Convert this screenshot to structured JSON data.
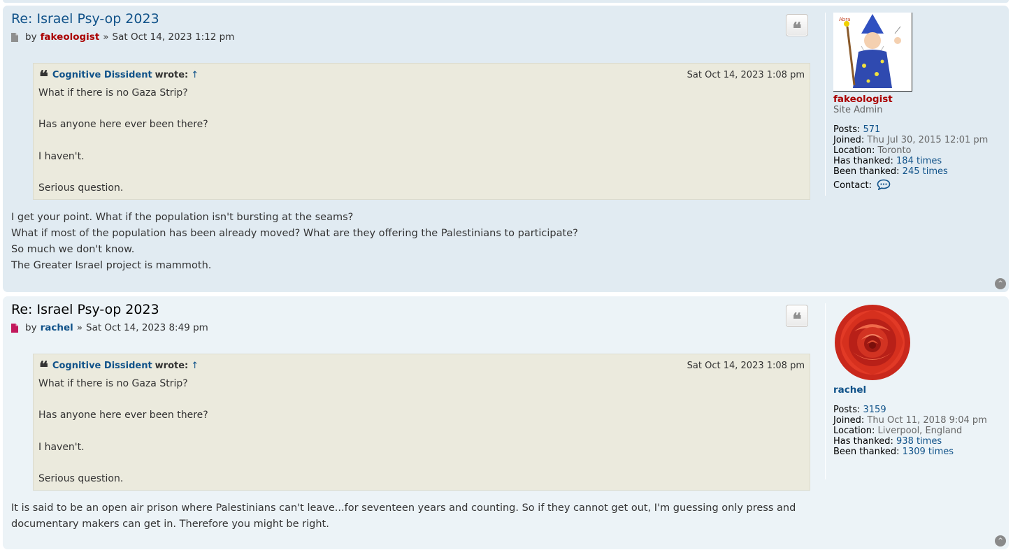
{
  "posts": [
    {
      "title": "Re: Israel Psy-op 2023",
      "by": "by",
      "author": "fakeologist",
      "separator": "»",
      "date": "Sat Oct 14, 2023 1:12 pm",
      "quote_button_glyph": "❝",
      "quote": {
        "author": "Cognitive Dissident",
        "wrote": "wrote:",
        "arrow": "↑",
        "date": "Sat Oct 14, 2023 1:08 pm",
        "lines": [
          "What if there is no Gaza Strip?",
          "",
          "Has anyone here ever been there?",
          "",
          "I haven't.",
          "",
          "Serious question."
        ]
      },
      "body": [
        "I get your point. What if the population isn't bursting at the seams?",
        "What if most of the population has been already moved? What are they offering the Palestinians to participate?",
        "So much we don't know.",
        "The Greater Israel project is mammoth."
      ],
      "profile": {
        "name": "fakeologist",
        "rank": "Site Admin",
        "posts_label": "Posts:",
        "posts": "571",
        "joined_label": "Joined:",
        "joined": "Thu Jul 30, 2015 12:01 pm",
        "location_label": "Location:",
        "location": "Toronto",
        "thanked_label": "Has thanked:",
        "thanked": "184 times",
        "been_thanked_label": "Been thanked:",
        "been_thanked": "245 times",
        "contact_label": "Contact:",
        "avatar_icon": "wizard-avatar",
        "name_color": "#aa0000"
      }
    },
    {
      "title": "Re: Israel Psy-op 2023",
      "by": "by",
      "author": "rachel",
      "separator": "»",
      "date": "Sat Oct 14, 2023 8:49 pm",
      "quote_button_glyph": "❝",
      "quote": {
        "author": "Cognitive Dissident",
        "wrote": "wrote:",
        "arrow": "↑",
        "date": "Sat Oct 14, 2023 1:08 pm",
        "lines": [
          "What if there is no Gaza Strip?",
          "",
          "Has anyone here ever been there?",
          "",
          "I haven't.",
          "",
          "Serious question."
        ]
      },
      "body": [
        "It is said to be an open air prison where Palestinians can't leave...for seventeen years and counting. So if they cannot get out, I'm guessing only press and documentary makers can get in. Therefore you might be right."
      ],
      "profile": {
        "name": "rachel",
        "posts_label": "Posts:",
        "posts": "3159",
        "joined_label": "Joined:",
        "joined": "Thu Oct 11, 2018 9:04 pm",
        "location_label": "Location:",
        "location": "Liverpool, England",
        "thanked_label": "Has thanked:",
        "thanked": "938 times",
        "been_thanked_label": "Been thanked:",
        "been_thanked": "1309 times",
        "avatar_icon": "rose-avatar",
        "name_color": "#105289"
      }
    }
  ],
  "colors": {
    "post_bg_1": "#e1ebf2",
    "post_bg_2": "#ecf3f7",
    "link": "#105289",
    "admin": "#aa0000",
    "quote_bg": "#ebeadd"
  },
  "icons": {
    "back_to_top": "chevron-up-circle-icon",
    "post_doc": "document-icon",
    "contact": "speech-bubble-icon"
  },
  "back_to_top_glyph": "^"
}
